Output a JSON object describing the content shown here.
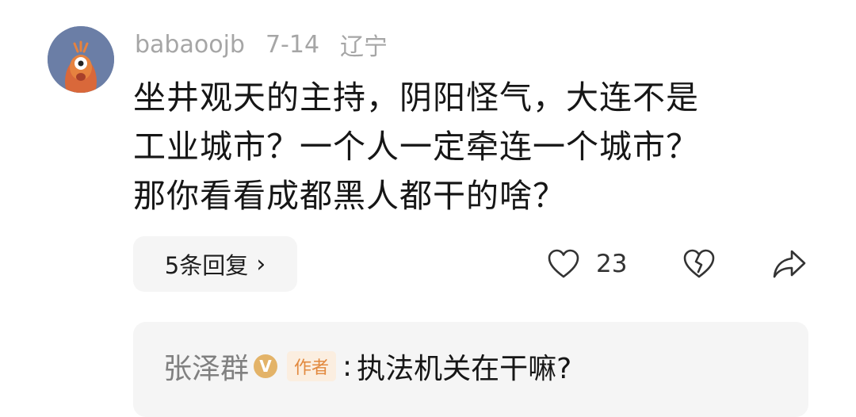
{
  "comment": {
    "username": "babaoojb",
    "date": "7-14",
    "location": "辽宁",
    "lines": [
      "坐井观天的主持，阴阳怪气，大连不是",
      "工业城市？一个人一定牵连一个城市？",
      "那你看看成都黑人都干的啥？"
    ],
    "replies_label": "5条回复",
    "like_count": "23",
    "avatar_color": "#6b7ea6"
  },
  "reply": {
    "name": "张泽群",
    "verified_badge": "V",
    "author_tag": "作者",
    "colon": ":",
    "text": "执法机关在干嘛?"
  }
}
